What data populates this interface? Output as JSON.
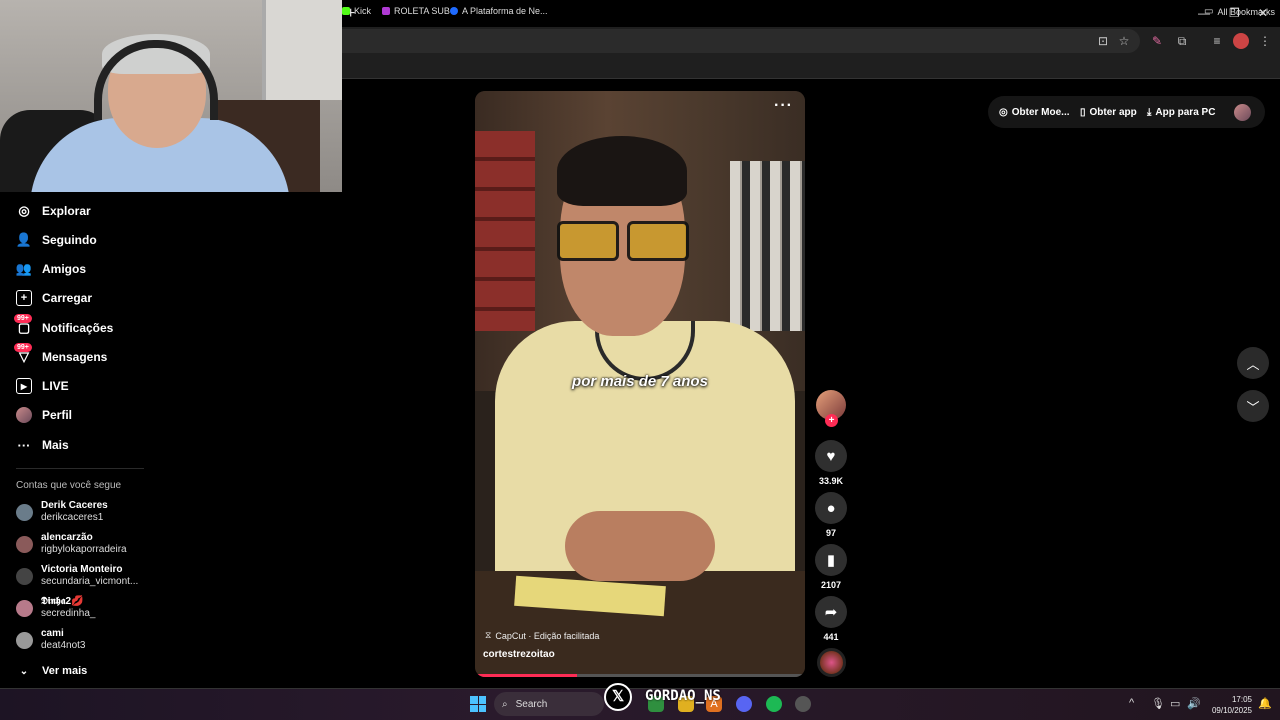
{
  "browser": {
    "new_tab": "+",
    "window_controls": [
      "—",
      "❐",
      "✕"
    ],
    "bookmarks": [
      {
        "label": "Kick",
        "color": "#53fc18"
      },
      {
        "label": "ROLETA SUB",
        "color": "#b03ad4"
      },
      {
        "label": "A Plataforma de Ne...",
        "color": "#1f6bff"
      }
    ],
    "all_bookmarks": "All Bookmarks"
  },
  "nav": {
    "items": [
      {
        "label": "Explorar",
        "icon": "compass-icon"
      },
      {
        "label": "Seguindo",
        "icon": "following-icon"
      },
      {
        "label": "Amigos",
        "icon": "friends-icon"
      },
      {
        "label": "Carregar",
        "icon": "upload-icon"
      },
      {
        "label": "Notificações",
        "icon": "inbox-icon",
        "badge": "99+"
      },
      {
        "label": "Mensagens",
        "icon": "messages-icon",
        "badge": "99+"
      },
      {
        "label": "LIVE",
        "icon": "live-icon"
      },
      {
        "label": "Perfil",
        "icon": "avatar"
      },
      {
        "label": "Mais",
        "icon": "more-icon"
      }
    ],
    "following_title": "Contas que você segue",
    "accounts": [
      {
        "name": "Derik Caceres",
        "user": "derikcaceres1"
      },
      {
        "name": "alencarzão",
        "user": "rigbylokaporradeira"
      },
      {
        "name": "Victoria Monteiro",
        "user": "secundaria_vicmont..."
      },
      {
        "name": "𝕯𝖎𝖓𝖍𝖆2💋",
        "user": "secredinha_"
      },
      {
        "name": "cami",
        "user": "deat4not3"
      }
    ],
    "see_more": "Ver mais"
  },
  "video": {
    "caption": "por mais de 7 anos",
    "more": "···",
    "capcut": "CapCut · Edição facilitada",
    "author": "cortestrezoitao",
    "progress": 0.31
  },
  "rail": {
    "likes": "33.9K",
    "comments": "97",
    "saves": "2107",
    "shares": "441"
  },
  "topbar": {
    "coins": "Obter Moe...",
    "get_app": "Obter app",
    "pc_app": "App para PC"
  },
  "taskbar": {
    "search": "Search",
    "time": "17:05",
    "date": "09/10/2025"
  },
  "overlay": {
    "x_logo": "𝕏",
    "handle": "GORDAO_NS"
  }
}
